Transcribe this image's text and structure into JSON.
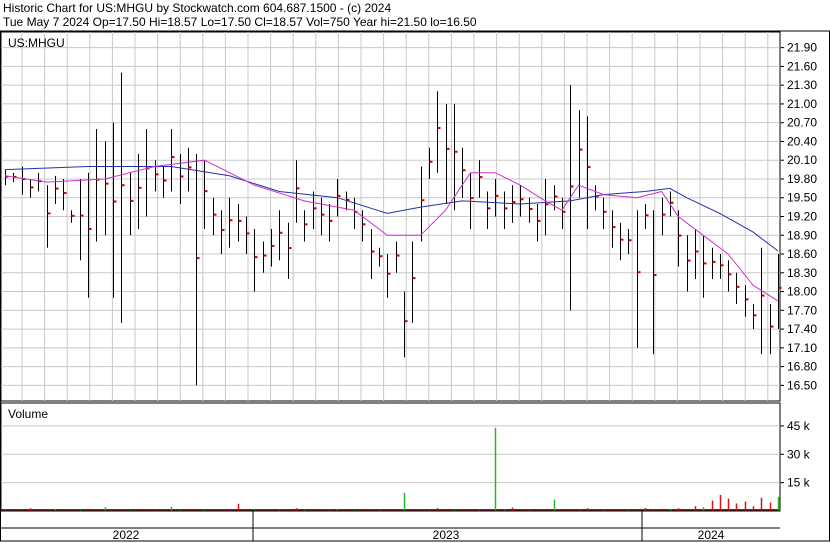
{
  "header": {
    "title": "Historic Chart for US:MHGU by Stockwatch.com 604.687.1500 - (c) 2024",
    "info": "Tue May  7 2024   Op=17.50   Hi=18.57   Lo=17.50   Cl=18.57   Vol=750   Year hi=21.50   lo=16.50"
  },
  "chart_data": [
    {
      "type": "line",
      "title": "US:MHGU",
      "description_series": [
        {
          "name": "",
          "kind": "ohlc",
          "color": "#000000"
        },
        {
          "name": "",
          "kind": "moving-average-short",
          "color": "#cc33cc"
        },
        {
          "name": "",
          "kind": "moving-average-long",
          "color": "#2233aa"
        }
      ],
      "y_ticks": [
        "21.90",
        "21.60",
        "21.30",
        "21.00",
        "20.70",
        "20.40",
        "20.10",
        "19.80",
        "19.50",
        "19.20",
        "18.90",
        "18.60",
        "18.30",
        "18.00",
        "17.70",
        "17.40",
        "17.10",
        "16.80",
        "16.50"
      ],
      "ylim": [
        16.25,
        22.15
      ],
      "grid": true,
      "ohlc": [
        [
          0,
          19.95,
          19.7
        ],
        [
          1,
          19.9,
          19.75
        ],
        [
          2,
          20.0,
          19.55
        ],
        [
          3,
          19.8,
          19.5
        ],
        [
          4,
          19.9,
          19.6
        ],
        [
          5,
          19.7,
          18.7
        ],
        [
          6,
          19.85,
          19.4
        ],
        [
          7,
          19.8,
          19.3
        ],
        [
          8,
          19.3,
          19.1
        ],
        [
          9,
          19.8,
          18.5
        ],
        [
          10,
          19.9,
          17.9
        ],
        [
          11,
          20.6,
          18.8
        ],
        [
          12,
          20.4,
          18.9
        ],
        [
          13,
          20.7,
          17.9
        ],
        [
          14,
          21.5,
          17.5
        ],
        [
          15,
          19.9,
          18.9
        ],
        [
          16,
          20.2,
          19.0
        ],
        [
          17,
          20.6,
          19.2
        ],
        [
          18,
          20.1,
          19.6
        ],
        [
          19,
          20.0,
          19.5
        ],
        [
          20,
          20.6,
          19.6
        ],
        [
          21,
          20.2,
          19.4
        ],
        [
          22,
          20.3,
          19.6
        ],
        [
          23,
          20.2,
          16.5
        ],
        [
          24,
          20.1,
          19.0
        ],
        [
          25,
          19.5,
          18.9
        ],
        [
          26,
          19.3,
          18.6
        ],
        [
          27,
          19.5,
          18.7
        ],
        [
          28,
          19.4,
          18.8
        ],
        [
          29,
          19.2,
          18.6
        ],
        [
          30,
          19.0,
          18.0
        ],
        [
          31,
          18.8,
          18.3
        ],
        [
          32,
          19.0,
          18.4
        ],
        [
          33,
          19.3,
          18.5
        ],
        [
          34,
          19.1,
          18.2
        ],
        [
          35,
          20.1,
          19.1
        ],
        [
          36,
          19.3,
          18.8
        ],
        [
          37,
          19.6,
          19.0
        ],
        [
          38,
          19.5,
          18.9
        ],
        [
          39,
          19.4,
          18.8
        ],
        [
          40,
          19.8,
          19.2
        ],
        [
          41,
          19.6,
          19.3
        ],
        [
          42,
          19.5,
          19.0
        ],
        [
          43,
          19.3,
          18.8
        ],
        [
          44,
          19.0,
          18.2
        ],
        [
          45,
          18.7,
          18.4
        ],
        [
          46,
          18.6,
          17.9
        ],
        [
          47,
          18.8,
          18.3
        ],
        [
          48,
          18.0,
          16.95
        ],
        [
          49,
          18.8,
          17.5
        ],
        [
          50,
          20.0,
          18.8
        ],
        [
          51,
          20.3,
          19.8
        ],
        [
          52,
          21.2,
          19.9
        ],
        [
          53,
          21.0,
          19.4
        ],
        [
          54,
          21.0,
          19.3
        ],
        [
          55,
          20.3,
          19.5
        ],
        [
          56,
          19.9,
          19.0
        ],
        [
          57,
          20.1,
          19.5
        ],
        [
          58,
          19.6,
          19.0
        ],
        [
          59,
          19.8,
          19.2
        ],
        [
          60,
          19.6,
          19.0
        ],
        [
          61,
          19.7,
          19.1
        ],
        [
          62,
          19.7,
          19.2
        ],
        [
          63,
          19.5,
          19.1
        ],
        [
          64,
          19.4,
          18.8
        ],
        [
          65,
          19.8,
          18.9
        ],
        [
          66,
          19.7,
          19.3
        ],
        [
          67,
          19.5,
          19.0
        ],
        [
          68,
          21.3,
          17.7
        ],
        [
          69,
          20.9,
          19.5
        ],
        [
          70,
          20.8,
          19.0
        ],
        [
          71,
          19.7,
          19.3
        ],
        [
          72,
          19.5,
          19.0
        ],
        [
          73,
          19.3,
          18.7
        ],
        [
          74,
          19.1,
          18.5
        ],
        [
          75,
          19.0,
          18.6
        ],
        [
          76,
          19.3,
          17.1
        ],
        [
          77,
          19.4,
          19.0
        ],
        [
          78,
          19.3,
          17.0
        ],
        [
          79,
          19.5,
          18.9
        ],
        [
          80,
          19.6,
          19.2
        ],
        [
          81,
          19.3,
          18.4
        ],
        [
          82,
          18.9,
          18.0
        ],
        [
          83,
          19.0,
          18.2
        ],
        [
          84,
          18.9,
          17.9
        ],
        [
          85,
          18.7,
          18.2
        ],
        [
          86,
          18.6,
          18.2
        ],
        [
          87,
          18.5,
          18.0
        ],
        [
          88,
          18.3,
          17.8
        ],
        [
          89,
          18.1,
          17.6
        ],
        [
          90,
          17.8,
          17.4
        ],
        [
          91,
          18.7,
          17.0
        ],
        [
          92,
          17.8,
          17.0
        ],
        [
          93,
          18.6,
          17.4
        ]
      ],
      "ma_short": [
        [
          0,
          19.85
        ],
        [
          5,
          19.75
        ],
        [
          12,
          19.8
        ],
        [
          18,
          20.0
        ],
        [
          24,
          20.1
        ],
        [
          30,
          19.7
        ],
        [
          36,
          19.45
        ],
        [
          42,
          19.3
        ],
        [
          46,
          18.9
        ],
        [
          50,
          18.9
        ],
        [
          53,
          19.3
        ],
        [
          56,
          19.9
        ],
        [
          59,
          19.9
        ],
        [
          62,
          19.7
        ],
        [
          65,
          19.45
        ],
        [
          67,
          19.3
        ],
        [
          69,
          19.7
        ],
        [
          72,
          19.55
        ],
        [
          76,
          19.5
        ],
        [
          79,
          19.6
        ],
        [
          81,
          19.2
        ],
        [
          84,
          18.9
        ],
        [
          87,
          18.6
        ],
        [
          90,
          18.1
        ],
        [
          93,
          17.85
        ]
      ],
      "ma_long": [
        [
          0,
          19.95
        ],
        [
          10,
          20.0
        ],
        [
          20,
          20.0
        ],
        [
          27,
          19.85
        ],
        [
          33,
          19.6
        ],
        [
          40,
          19.5
        ],
        [
          46,
          19.25
        ],
        [
          50,
          19.35
        ],
        [
          55,
          19.45
        ],
        [
          62,
          19.4
        ],
        [
          68,
          19.45
        ],
        [
          72,
          19.55
        ],
        [
          77,
          19.6
        ],
        [
          80,
          19.65
        ],
        [
          82,
          19.5
        ],
        [
          86,
          19.25
        ],
        [
          90,
          18.95
        ],
        [
          93,
          18.65
        ]
      ]
    },
    {
      "type": "bar",
      "title": "Volume",
      "y_ticks": [
        "45 k",
        "30 k",
        "15 k"
      ],
      "ylim": [
        0,
        55
      ],
      "volumes": [
        [
          3,
          1.5,
          "r"
        ],
        [
          6,
          1.2,
          "g"
        ],
        [
          12,
          2.0,
          "g"
        ],
        [
          18,
          1.0,
          "r"
        ],
        [
          20,
          2.2,
          "g"
        ],
        [
          28,
          3.8,
          "r"
        ],
        [
          35,
          1.5,
          "r"
        ],
        [
          40,
          1.2,
          "g"
        ],
        [
          48,
          9.5,
          "g"
        ],
        [
          52,
          1.5,
          "r"
        ],
        [
          59,
          44,
          "g"
        ],
        [
          61,
          1.8,
          "r"
        ],
        [
          66,
          6.0,
          "g"
        ],
        [
          70,
          1.5,
          "r"
        ],
        [
          77,
          1.6,
          "r"
        ],
        [
          80,
          1.0,
          "g"
        ],
        [
          81,
          1.5,
          "r"
        ],
        [
          83,
          2.5,
          "r"
        ],
        [
          84,
          2.0,
          "g"
        ],
        [
          85,
          5.5,
          "r"
        ],
        [
          86,
          8.5,
          "r"
        ],
        [
          87,
          6.5,
          "r"
        ],
        [
          88,
          4.0,
          "r"
        ],
        [
          89,
          5.0,
          "r"
        ],
        [
          90,
          2.5,
          "r"
        ],
        [
          91,
          7.0,
          "r"
        ],
        [
          92,
          4.5,
          "r"
        ],
        [
          93,
          7.5,
          "g"
        ]
      ]
    }
  ],
  "x_axis": {
    "year_labels": [
      "2022",
      "2023",
      "2024"
    ]
  }
}
